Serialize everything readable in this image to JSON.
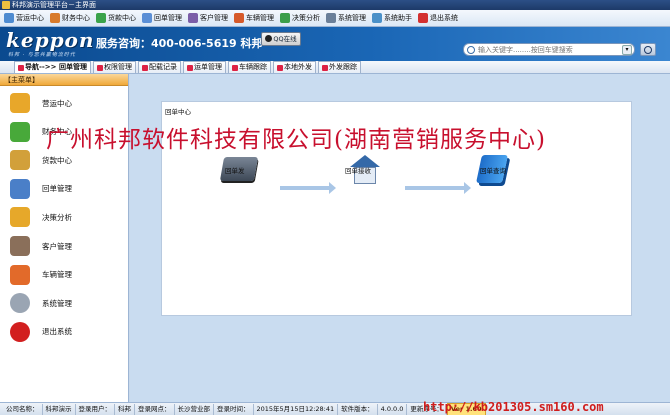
{
  "window": {
    "title": "科邦演示管理平台－主界面"
  },
  "menu": [
    {
      "label": "营运中心",
      "icon": "ops-center-icon",
      "color": "#4e8bd0"
    },
    {
      "label": "财务中心",
      "icon": "finance-icon",
      "color": "#d87b2c"
    },
    {
      "label": "货款中心",
      "icon": "payment-icon",
      "color": "#3aa34b"
    },
    {
      "label": "回单管理",
      "icon": "receipt-icon",
      "color": "#5b8fd6"
    },
    {
      "label": "客户管理",
      "icon": "customer-icon",
      "color": "#7b5ea8"
    },
    {
      "label": "车辆管理",
      "icon": "truck-icon",
      "color": "#d65a2a"
    },
    {
      "label": "决策分析",
      "icon": "analysis-icon",
      "color": "#3b9e4a"
    },
    {
      "label": "系统管理",
      "icon": "system-icon",
      "color": "#6a7f99"
    },
    {
      "label": "系统助手",
      "icon": "assistant-icon",
      "color": "#4a90c8"
    },
    {
      "label": "退出系统",
      "icon": "exit-icon",
      "color": "#d33030"
    }
  ],
  "banner": {
    "logo": "keppon",
    "slogan": "科邦 · 与您共赢物流时代",
    "hotline": "服务咨询：400-006-5619 科邦",
    "qq_label": "QQ在线"
  },
  "search": {
    "placeholder": "输入关键字........按回车键搜索"
  },
  "tabs": [
    {
      "label": "导航-->> 回单管理",
      "active": true
    },
    {
      "label": "权限管理",
      "active": false
    },
    {
      "label": "配载记录",
      "active": false
    },
    {
      "label": "运单管理",
      "active": false
    },
    {
      "label": "车辆跟踪",
      "active": false
    },
    {
      "label": "本地外发",
      "active": false
    },
    {
      "label": "外发跟踪",
      "active": false
    }
  ],
  "sidebar": {
    "header": "【主菜单】",
    "items": [
      {
        "label": "营运中心",
        "icon": "ops-center-icon",
        "color": "#e8a72a"
      },
      {
        "label": "财务中心",
        "icon": "finance-icon",
        "color": "#48a93a"
      },
      {
        "label": "货款中心",
        "icon": "payment-icon",
        "color": "#d2a03a"
      },
      {
        "label": "回单管理",
        "icon": "receipt-icon",
        "color": "#4a7fc8"
      },
      {
        "label": "决策分析",
        "icon": "analysis-icon",
        "color": "#e6a82a"
      },
      {
        "label": "客户管理",
        "icon": "customer-icon",
        "color": "#8a6f5a"
      },
      {
        "label": "车辆管理",
        "icon": "truck-icon",
        "color": "#e26a2a"
      },
      {
        "label": "系统管理",
        "icon": "gear-icon",
        "color": "#9aa5b3"
      },
      {
        "label": "退出系统",
        "icon": "power-icon",
        "color": "#d21f1f"
      }
    ]
  },
  "panel": {
    "title": "回单中心",
    "nodes": [
      {
        "label": "回单发",
        "icon": "receipt-send-icon"
      },
      {
        "label": "回单接收",
        "icon": "receipt-receive-icon"
      },
      {
        "label": "回单查询",
        "icon": "receipt-query-icon"
      }
    ]
  },
  "watermark": "广州科邦软件科技有限公司(湖南营销服务中心)",
  "status": {
    "cells": [
      "公司名称：",
      "科邦演示",
      "登录用户：",
      "科邦",
      "登录网点：",
      "长沙营业部",
      "登录时间：",
      "2015年5月15日12:28:41",
      "软件版本：",
      "4.0.0.0",
      "更新序号："
    ],
    "version": "Ver 1.60",
    "url_mark": "http://kb201305.sm160.com"
  }
}
